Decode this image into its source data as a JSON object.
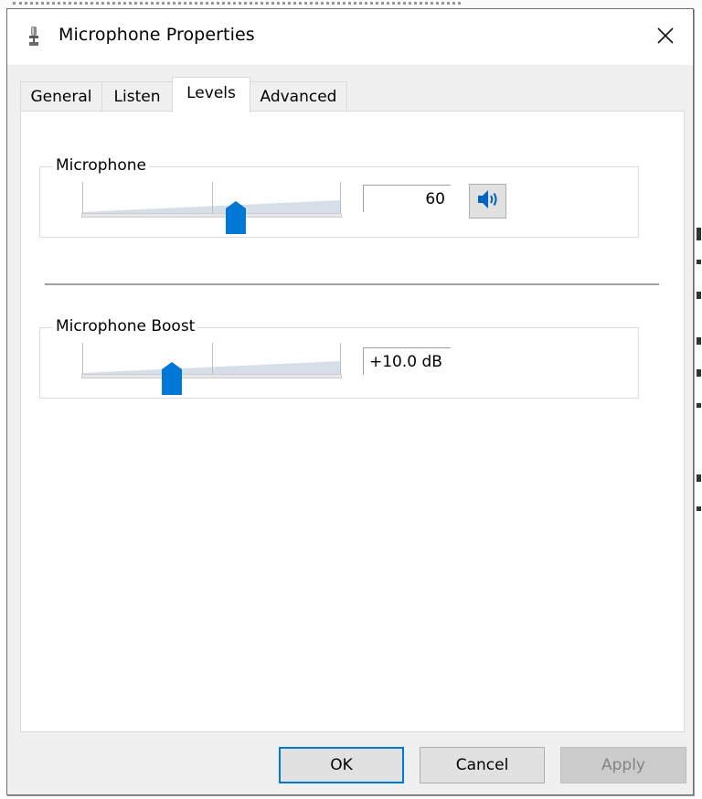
{
  "window": {
    "title": "Microphone Properties",
    "title_icon": "microphone-icon",
    "close_icon": "close-icon"
  },
  "tabs": [
    {
      "label": "General",
      "active": false
    },
    {
      "label": "Listen",
      "active": false
    },
    {
      "label": "Levels",
      "active": true
    },
    {
      "label": "Advanced",
      "active": false
    }
  ],
  "levels": {
    "microphone": {
      "label": "Microphone",
      "value_text": "60",
      "value": 60,
      "min": 0,
      "max": 100,
      "mute_button_icon": "speaker-icon"
    },
    "boost": {
      "label": "Microphone Boost",
      "value_text": "+10.0 dB",
      "value": 10.0,
      "min": 0,
      "max": 30
    }
  },
  "buttons": {
    "ok": "OK",
    "cancel": "Cancel",
    "apply": "Apply"
  },
  "colors": {
    "accent": "#0078d7",
    "slider_fill": "#d6dfe8",
    "track": "#e6e6e6"
  }
}
